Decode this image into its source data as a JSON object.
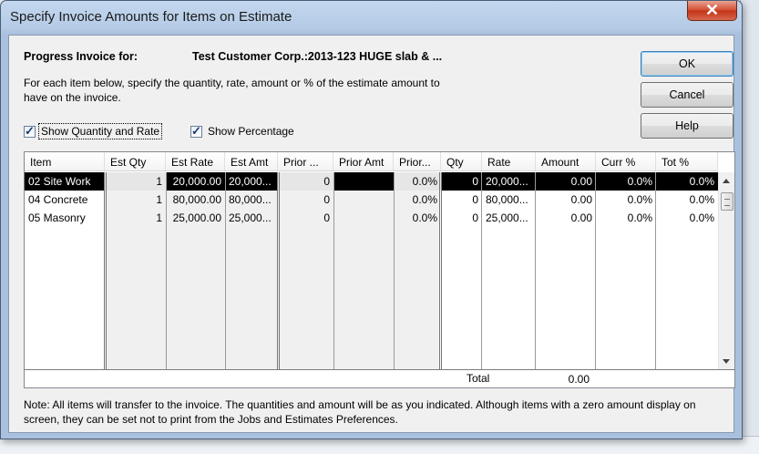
{
  "window": {
    "title": "Specify Invoice Amounts for Items on Estimate",
    "close_glyph": "✕"
  },
  "header": {
    "progress_label": "Progress Invoice for:",
    "customer": "Test Customer Corp.:2013-123 HUGE slab & ...",
    "instructions": "For each item below, specify the quantity, rate, amount or % of the estimate amount to have on the invoice."
  },
  "options": {
    "show_qty_rate": {
      "label": "Show Quantity and Rate",
      "checked": true
    },
    "show_percentage": {
      "label": "Show Percentage",
      "checked": true
    }
  },
  "buttons": {
    "ok": "OK",
    "cancel": "Cancel",
    "help": "Help"
  },
  "table": {
    "columns": [
      "Item",
      "Est Qty",
      "Est Rate",
      "Est Amt",
      "Prior ...",
      "Prior Amt",
      "Prior...",
      "Qty",
      "Rate",
      "Amount",
      "Curr %",
      "Tot %"
    ],
    "rows": [
      [
        "02 Site Work",
        "1",
        "20,000.00",
        "20,000...",
        "0",
        "",
        "0.0%",
        "0",
        "20,000...",
        "0.00",
        "0.0%",
        "0.0%"
      ],
      [
        "04 Concrete",
        "1",
        "80,000.00",
        "80,000...",
        "0",
        "",
        "0.0%",
        "0",
        "80,000...",
        "0.00",
        "0.0%",
        "0.0%"
      ],
      [
        "05 Masonry",
        "1",
        "25,000.00",
        "25,000...",
        "0",
        "",
        "0.0%",
        "0",
        "25,000...",
        "0.00",
        "0.0%",
        "0.0%"
      ]
    ],
    "selected_row": 0,
    "total_label": "Total",
    "total_value": "0.00"
  },
  "note": "Note: All items will transfer to the invoice. The quantities and amount will be as you indicated. Although items with a zero amount display on screen, they can be set not to print from the Jobs and Estimates Preferences.",
  "colors": {
    "selection_dark": "#000000",
    "selection_light": "#e6e6e6",
    "titlebar": "#b5cbe6",
    "close_button": "#c23418"
  }
}
